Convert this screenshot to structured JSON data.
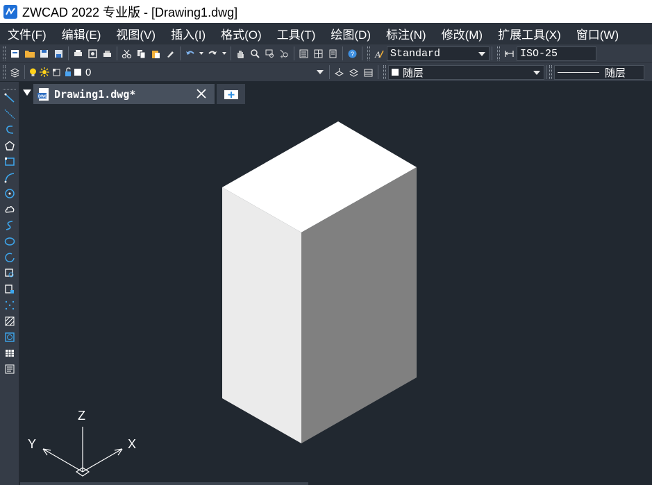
{
  "window": {
    "title": "ZWCAD 2022 专业版 - [Drawing1.dwg]"
  },
  "menu": {
    "items": [
      {
        "label": "文件(F)"
      },
      {
        "label": "编辑(E)"
      },
      {
        "label": "视图(V)"
      },
      {
        "label": "插入(I)"
      },
      {
        "label": "格式(O)"
      },
      {
        "label": "工具(T)"
      },
      {
        "label": "绘图(D)"
      },
      {
        "label": "标注(N)"
      },
      {
        "label": "修改(M)"
      },
      {
        "label": "扩展工具(X)"
      },
      {
        "label": "窗口(W)"
      }
    ]
  },
  "toolbar": {
    "text_style": "Standard",
    "dim_style": "ISO-25",
    "layer": "0",
    "color": "随层",
    "linetype": "随层"
  },
  "tabs": [
    {
      "label": "Drawing1.dwg*"
    }
  ],
  "ucs": {
    "x": "X",
    "y": "Y",
    "z": "Z"
  },
  "colors": {
    "background": "#212830",
    "toolbar": "#353c47",
    "accent": "#1fa2e8",
    "box_top": "#ffffff",
    "box_left": "#ebebeb",
    "box_right": "#808080"
  }
}
